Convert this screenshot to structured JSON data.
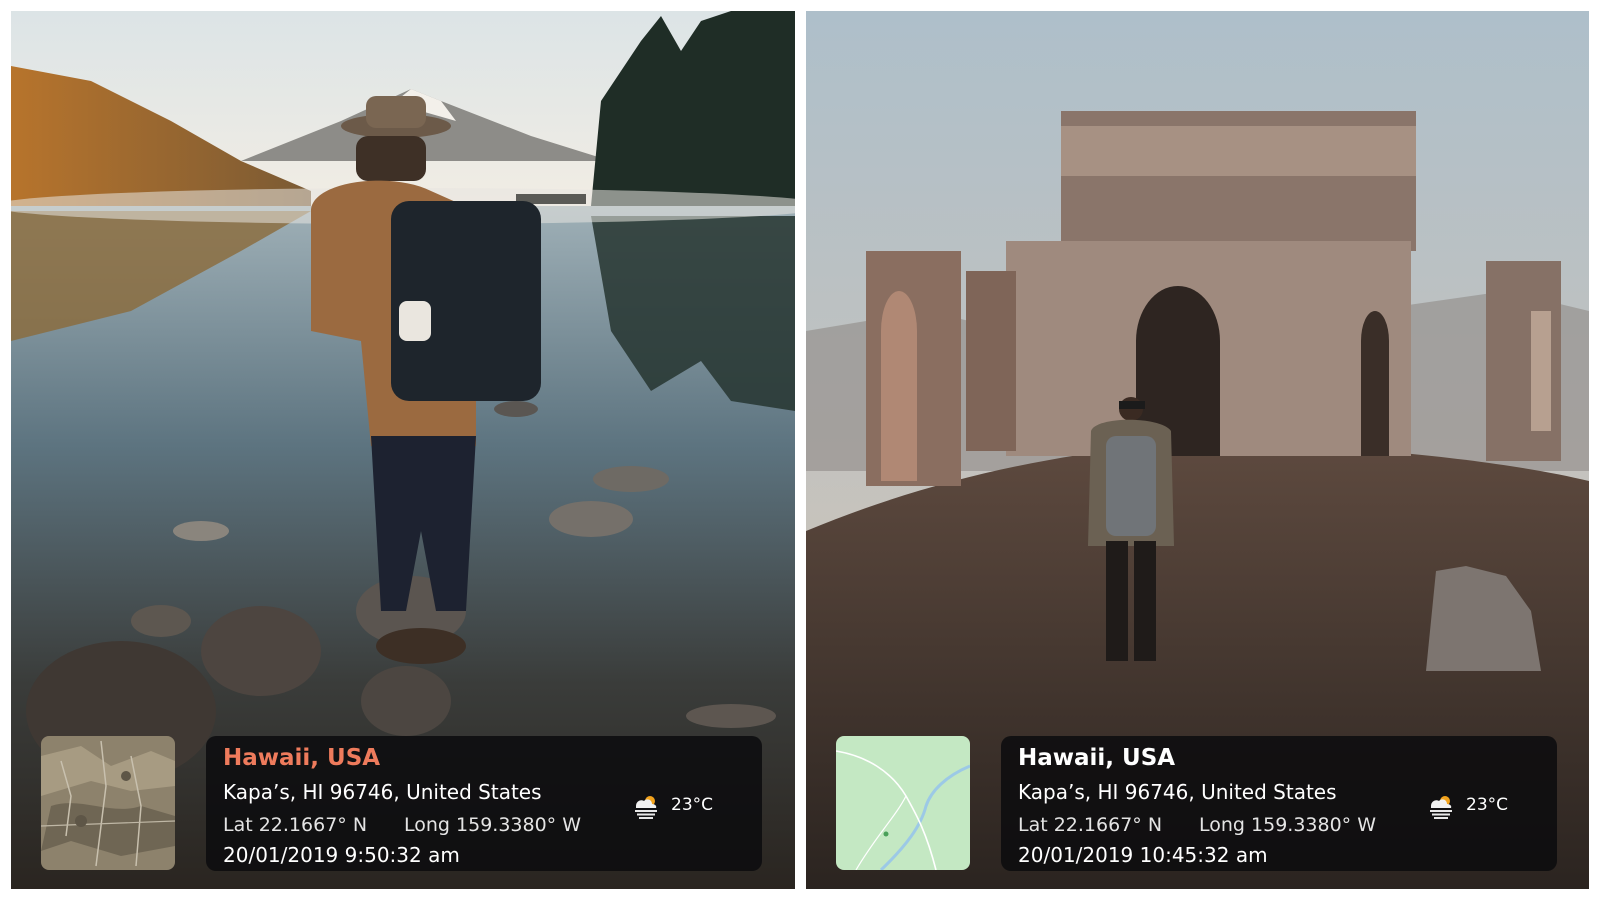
{
  "colors": {
    "location_accent": "#ee7b5c",
    "card_background": "#0c0c0e",
    "card_text": "#ffffff"
  },
  "panels": [
    {
      "scene": "person with backpack and hat standing on rocks at a misty mountain lake",
      "map_style": "satellite",
      "location": "Hawaii, USA",
      "address": "Kapa’s, HI 96746, United States",
      "latitude": "Lat 22.1667° N",
      "longitude": "Long 159.3380° W",
      "datetime": "20/01/2019 9:50:32 am",
      "weather_icon": "partly-sunny-icon",
      "temperature": "23°C"
    },
    {
      "scene": "person with backpack facing an old ruined building on a hill",
      "map_style": "road-map",
      "location": "Hawaii, USA",
      "address": "Kapa’s, HI 96746, United States",
      "latitude": "Lat 22.1667° N",
      "longitude": "Long 159.3380° W",
      "datetime": "20/01/2019 10:45:32 am",
      "weather_icon": "partly-sunny-icon",
      "temperature": "23°C"
    }
  ]
}
